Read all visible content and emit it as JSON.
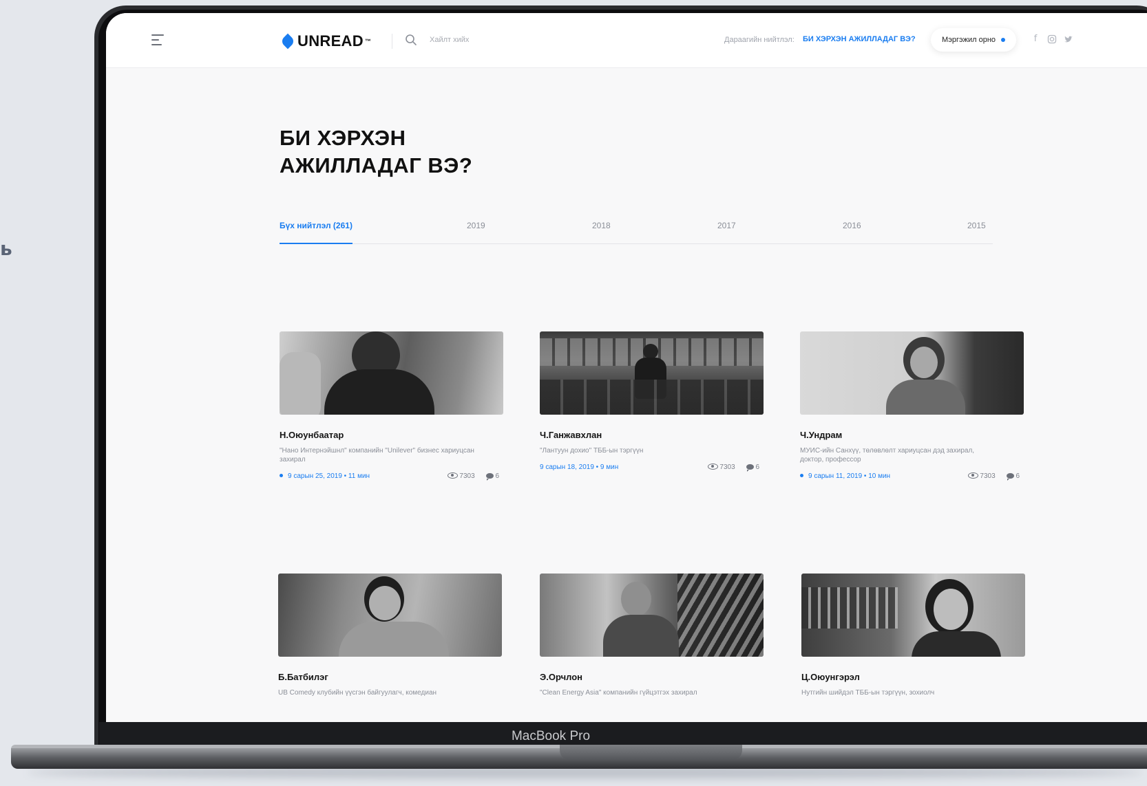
{
  "side_glyph": "ь",
  "device_label": "MacBook Pro",
  "header": {
    "brand": "UNREAD",
    "brand_tm": "™",
    "search_placeholder": "Хайлт хийх",
    "feature_label": "Дараагийн нийтлэл:",
    "feature_link": "БИ ХЭРХЭН АЖИЛЛАДАГ ВЭ?",
    "login_label": "Мэргэжил орно",
    "social_icons": [
      "facebook-icon",
      "instagram-icon",
      "twitter-icon"
    ]
  },
  "page": {
    "title_line1": "БИ ХЭРХЭН",
    "title_line2": "АЖИЛЛАДАГ ВЭ?"
  },
  "tabs": [
    {
      "label": "Бүх нийтлэл (261)",
      "active": true
    },
    {
      "label": "2019"
    },
    {
      "label": "2018"
    },
    {
      "label": "2017"
    },
    {
      "label": "2016"
    },
    {
      "label": "2015"
    }
  ],
  "articles": [
    {
      "name": "Н.Оюунбаатар",
      "desc": "\"Нано Интернэйшнл\" компанийн \"Unilever\" бизнес хариуцсан захирал",
      "date": "9 сарын 25, 2019 • 11 мин",
      "views": "7303",
      "comments": "6",
      "dot": true
    },
    {
      "name": "Ч.Ганжавхлан",
      "desc": "\"Лантуун дохио\" ТББ-ын тэргүүн",
      "date": "9 сарын 18, 2019 • 9 мин",
      "views": "7303",
      "comments": "6",
      "dot": false
    },
    {
      "name": "Ч.Ундрам",
      "desc": "МУИС-ийн Санхүү, төлөвлөлт хариуцсан дэд захирал, доктор, профессор",
      "date": "9 сарын 11, 2019 • 10 мин",
      "views": "7303",
      "comments": "6",
      "dot": true
    },
    {
      "name": "Б.Батбилэг",
      "desc": "UB Comedy клубийн үүсгэн байгуулагч, комедиан"
    },
    {
      "name": "Э.Орчлон",
      "desc": "\"Clean Energy Asia\" компанийн гүйцэтгэх захирал"
    },
    {
      "name": "Ц.Оюунгэрэл",
      "desc": "Нутгийн шийдэл ТББ-ын тэргүүн, зохиолч"
    }
  ],
  "colors": {
    "accent": "#1a7df0",
    "text": "#111111",
    "muted": "#8b8f98"
  }
}
